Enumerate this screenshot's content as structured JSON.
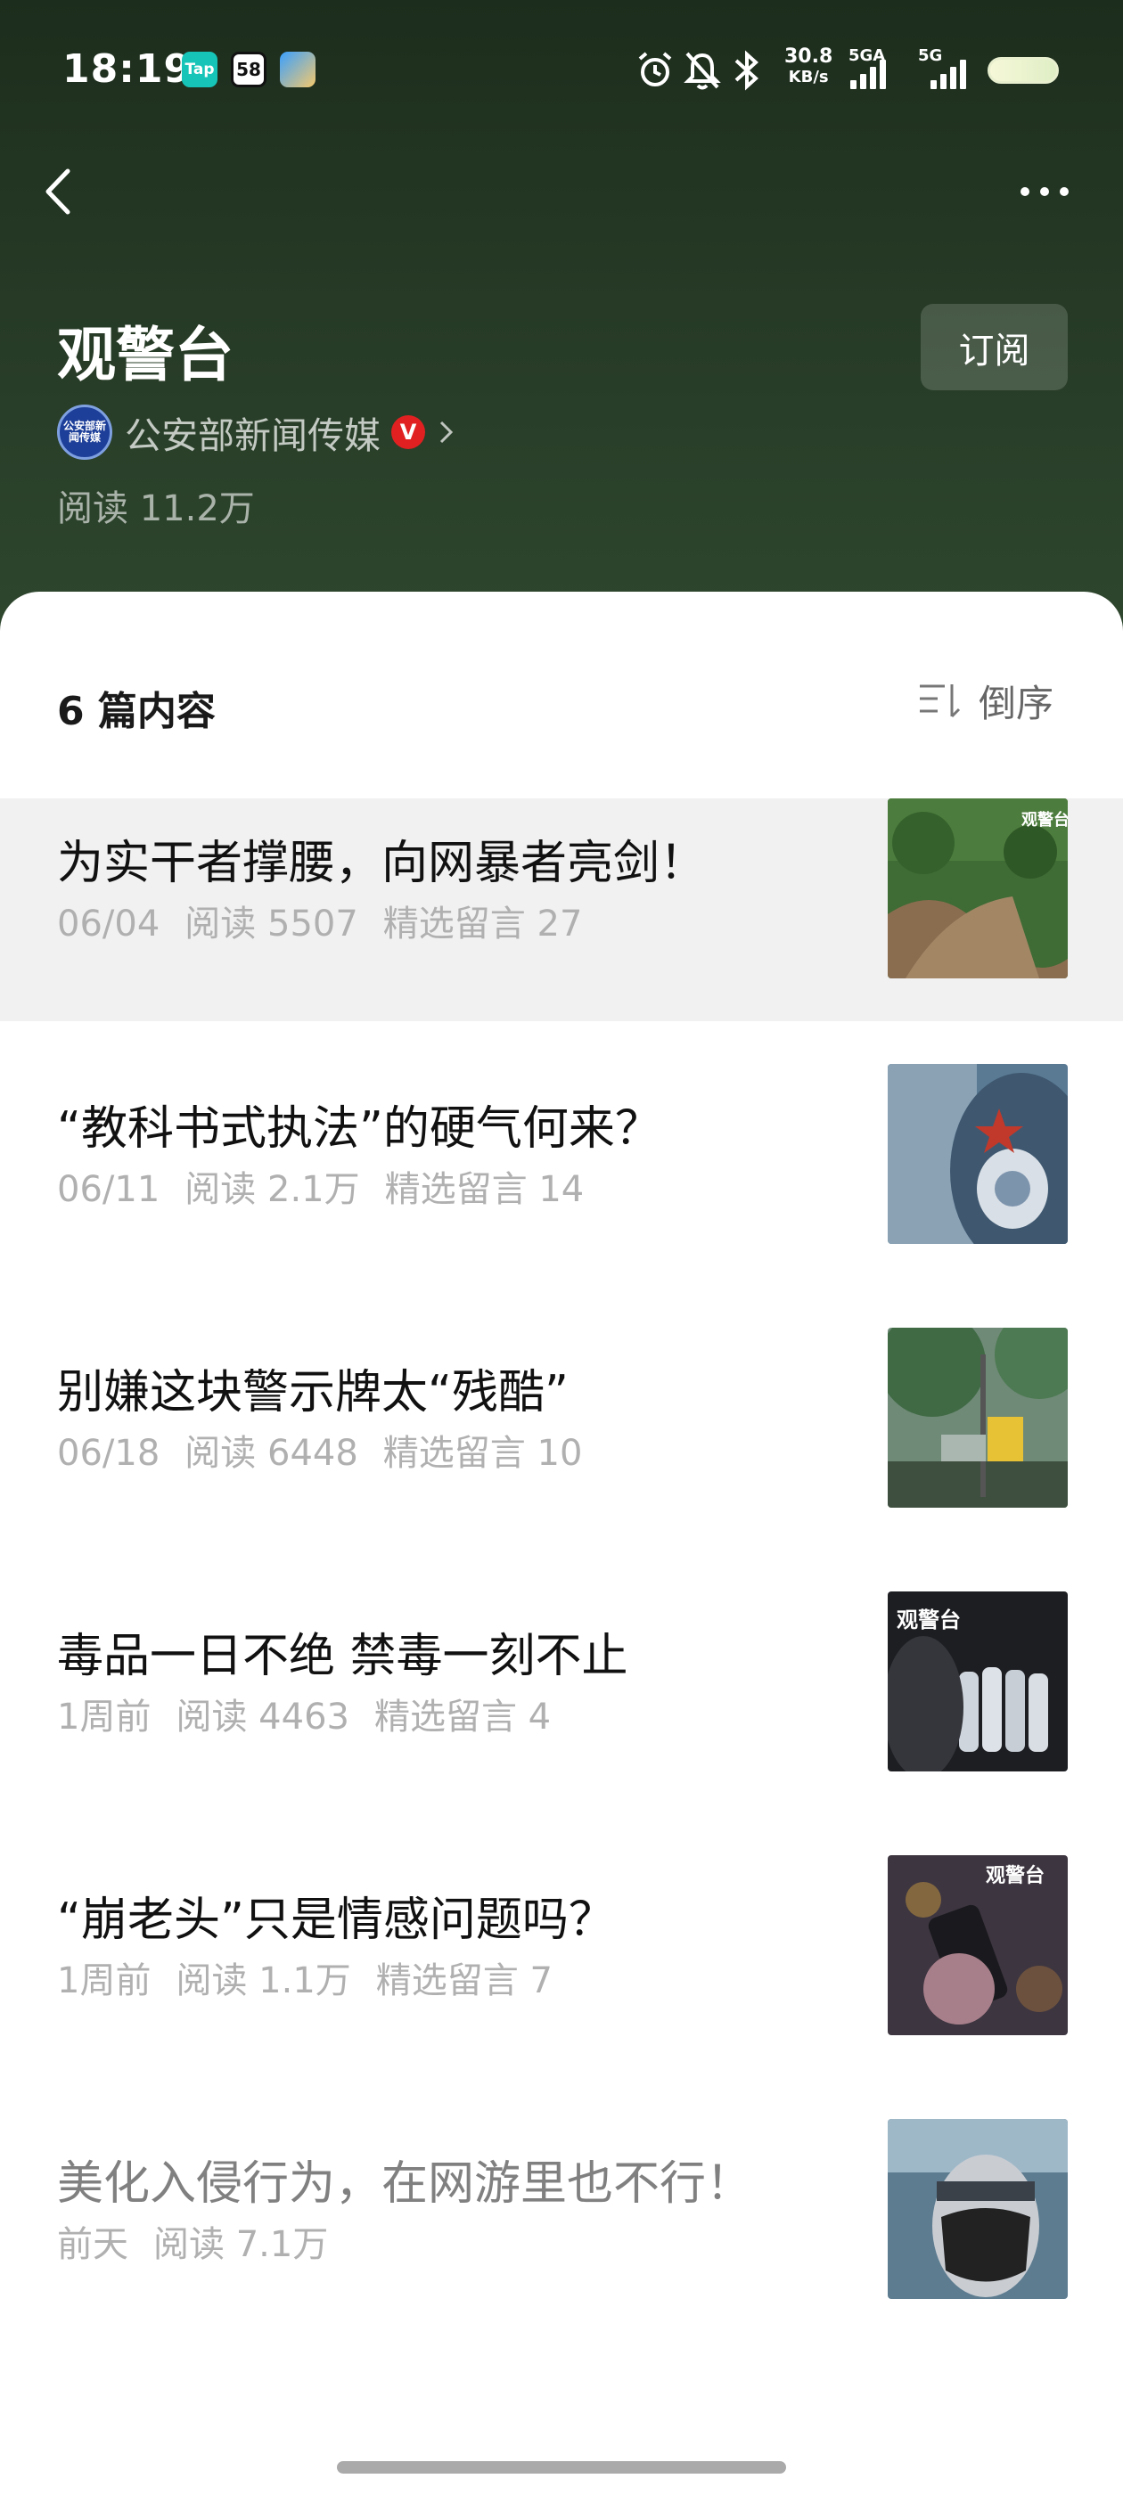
{
  "status_bar": {
    "time": "18:19",
    "apps": [
      "Tap",
      "58"
    ],
    "net_speed_value": "30.8",
    "net_speed_unit": "KB/s",
    "sim1_label": "5GA",
    "sim2_label": "5G"
  },
  "header": {
    "title": "观警台",
    "subscribe_label": "订阅",
    "author_avatar_text": "公安部新闻传媒",
    "author_name": "公安部新闻传媒",
    "verified_label": "V",
    "read_count": "阅读 11.2万"
  },
  "list": {
    "count_label": "6 篇内容",
    "sort_label": "倒序",
    "articles": [
      {
        "title": "为实干者撑腰，向网暴者亮剑！",
        "date": "06/04",
        "reads": "阅读 5507",
        "comments": "精选留言 27"
      },
      {
        "title": "“教科书式执法”的硬气何来？",
        "date": "06/11",
        "reads": "阅读 2.1万",
        "comments": "精选留言 14"
      },
      {
        "title": "别嫌这块警示牌太“残酷”",
        "date": "06/18",
        "reads": "阅读 6448",
        "comments": "精选留言 10"
      },
      {
        "title": "毒品一日不绝 禁毒一刻不止",
        "date": "1周前",
        "reads": "阅读 4463",
        "comments": "精选留言 4"
      },
      {
        "title": "“崩老头”只是情感问题吗？",
        "date": "1周前",
        "reads": "阅读 1.1万",
        "comments": "精选留言 7"
      },
      {
        "title": "美化入侵行为，在网游里也不行！",
        "date": "前天",
        "reads": "阅读 7.1万",
        "comments": ""
      }
    ],
    "thumb_watermark": "观警台"
  },
  "colors": {
    "header_bg": "#263a26",
    "highlight_row": "#f1f1f1",
    "verified_red": "#e12121",
    "meta_gray": "#b0b0b0"
  }
}
